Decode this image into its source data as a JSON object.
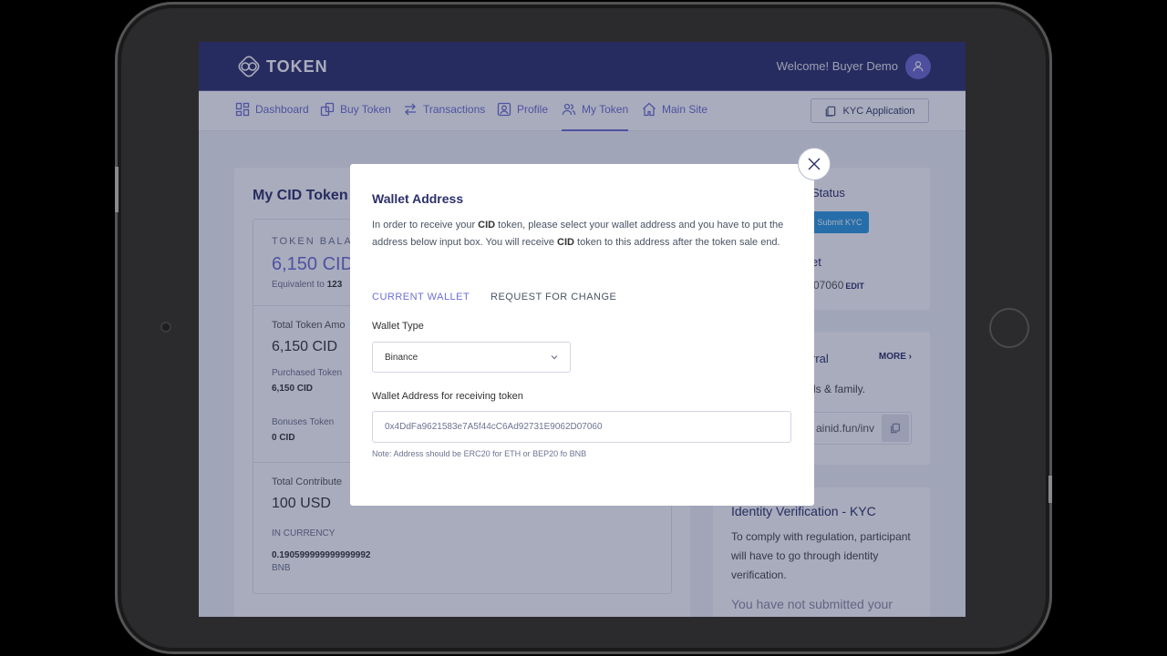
{
  "header": {
    "logo_text": "TOKEN",
    "welcome": "Welcome! Buyer Demo"
  },
  "nav": {
    "items": [
      {
        "label": "Dashboard",
        "icon": "dashboard-icon"
      },
      {
        "label": "Buy Token",
        "icon": "coins-icon"
      },
      {
        "label": "Transactions",
        "icon": "transfer-icon"
      },
      {
        "label": "Profile",
        "icon": "profile-icon"
      },
      {
        "label": "My Token",
        "icon": "users-icon",
        "active": true
      },
      {
        "label": "Main Site",
        "icon": "home-icon"
      }
    ],
    "kyc_button": "KYC Application"
  },
  "main": {
    "title": "My CID Token",
    "balance_label": "TOKEN BALAN",
    "balance_value": "6,150 CID",
    "equivalent_prefix": "Equivalent to",
    "equivalent_value": "123",
    "total_token_label": "Total Token Amo",
    "total_token_value": "6,150 CID",
    "purchased_label": "Purchased Token",
    "purchased_value": "6,150 CID",
    "bonus_label": "Bonuses Token",
    "bonus_value": "0 CID",
    "contributed_label": "Total Contribute",
    "contributed_value": "100 USD",
    "currency_label": "IN CURRENCY",
    "currency_value": "0.190599999999999992",
    "currency_unit": "BNB"
  },
  "right": {
    "status_title": "Status",
    "submit_kyc": "Submit KYC",
    "wallet_title": "et",
    "wallet_frag": "07060",
    "edit": "EDIT",
    "referral_title": "rral",
    "more": "MORE",
    "referral_text": "ls & family.",
    "referral_link": "ainid.fun/inv",
    "kyc_title": "Identity Verification - KYC",
    "kyc_text": "To comply with regulation, participant will have to go through identity verification.",
    "kyc_warn": "You have not submitted your documents to verify your identity"
  },
  "modal": {
    "title": "Wallet Address",
    "desc_1": "In order to receive your ",
    "desc_token_1": "CID",
    "desc_2": " token, please select your wallet address and you have to put the address below input box. You will receive ",
    "desc_token_2": "CID",
    "desc_3": " token to this address after the token sale end.",
    "tab_current": "CURRENT WALLET",
    "tab_request": "REQUEST FOR CHANGE",
    "wallet_type_label": "Wallet Type",
    "wallet_type_value": "Binance",
    "address_label": "Wallet Address for receiving token",
    "address_value": "0x4DdFa9621583e7A5f44cC6Ad92731E9062D07060",
    "note": "Note: Address should be ERC20 for ETH or BEP20 fo BNB"
  },
  "colors": {
    "primary": "#2d3169",
    "accent": "#6c6fd4",
    "kyc_button": "#2c9be0"
  }
}
